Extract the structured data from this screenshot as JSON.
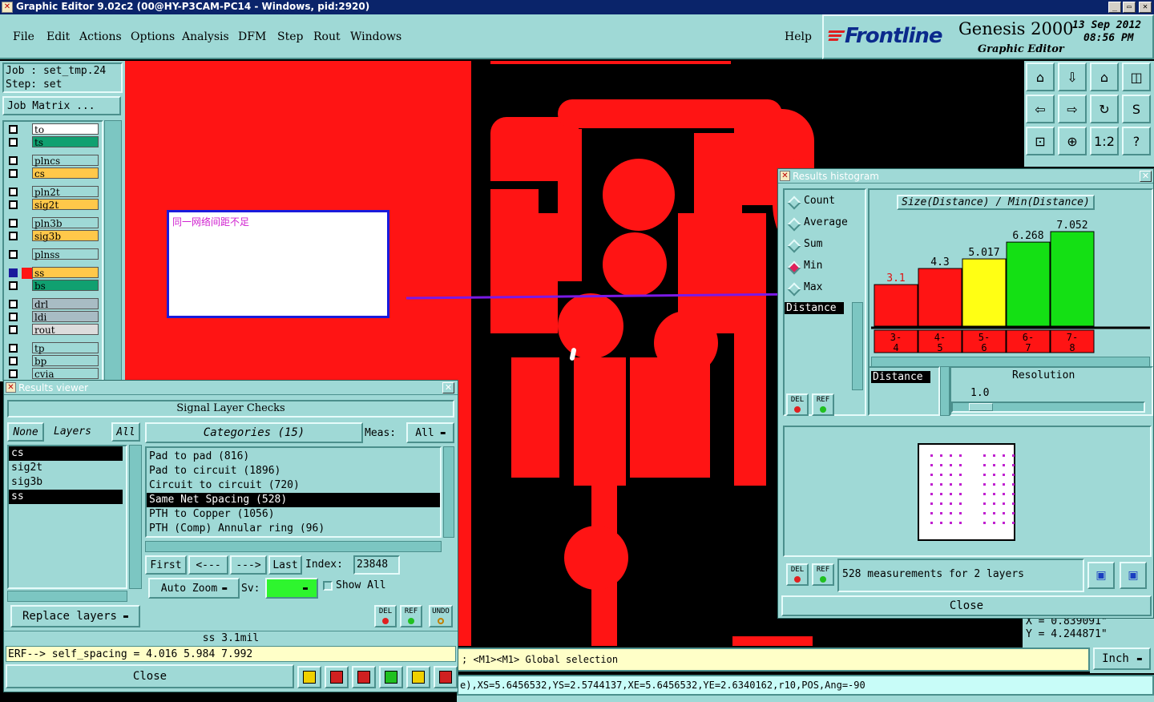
{
  "app": {
    "title": "Graphic Editor 9.02c2 (00@HY-P3CAM-PC14 - Windows, pid:2920)"
  },
  "menu": {
    "items": [
      "File",
      "Edit",
      "Actions",
      "Options",
      "Analysis",
      "DFM",
      "Step",
      "Rout",
      "Windows"
    ],
    "help": "Help"
  },
  "brand": {
    "logo": "Frontline",
    "product": "Genesis 2000",
    "subtitle": "Graphic Editor",
    "date": "13  Sep  2012",
    "time": "08:56  PM"
  },
  "job": {
    "job_line": "Job :  set_tmp.24",
    "step_line": "Step:  set",
    "matrix_button": "Job Matrix ..."
  },
  "layers": [
    {
      "name": "to",
      "color": "#ffffff"
    },
    {
      "name": "ts",
      "color": "#10a070"
    },
    {
      "name": "plncs",
      "color": "#9fd9d6"
    },
    {
      "name": "cs",
      "color": "#ffc84a"
    },
    {
      "name": "pln2t",
      "color": "#9fd9d6"
    },
    {
      "name": "sig2t",
      "color": "#ffc84a"
    },
    {
      "name": "pln3b",
      "color": "#9fd9d6"
    },
    {
      "name": "sig3b",
      "color": "#ffc84a"
    },
    {
      "name": "plnss",
      "color": "#9fd9d6"
    },
    {
      "name": "ss",
      "color": "#ffc84a"
    },
    {
      "name": "bs",
      "color": "#10a070"
    },
    {
      "name": "drl",
      "color": "#a8bcc4"
    },
    {
      "name": "ldi",
      "color": "#a8bcc4"
    },
    {
      "name": "rout",
      "color": "#dcdcdc"
    },
    {
      "name": "tp",
      "color": "#9fd9d6"
    },
    {
      "name": "bp",
      "color": "#9fd9d6"
    },
    {
      "name": "cvia",
      "color": "#9fd9d6"
    }
  ],
  "canvas": {
    "note_text": "同一网络间距不足",
    "coords_x": "X  =  0.839091\"",
    "coords_y": "Y  =  4.244871\""
  },
  "status": {
    "prompt": "; <M1><M1> Global selection",
    "unit": "Inch",
    "feature": "e),XS=5.6456532,YS=2.5744137,XE=5.6456532,YE=2.6340162,r10,POS,Ang=-90"
  },
  "results_viewer": {
    "title": "Results viewer",
    "header": "Signal Layer Checks",
    "none_btn": "None",
    "layers_label": "Layers",
    "all_btn": "All",
    "layer_list": [
      "cs",
      "sig2t",
      "sig3b",
      "ss"
    ],
    "categories_label": "Categories (15)",
    "meas_label": "Meas:",
    "meas_value": "All",
    "categories": [
      "Pad to pad (816)",
      "Pad to circuit (1896)",
      "Circuit to circuit (720)",
      "Same Net Spacing (528)",
      "PTH to Copper (1056)",
      "PTH (Comp) Annular ring (96)"
    ],
    "first_btn": "First",
    "prev_btn": "<---",
    "next_btn": "--->",
    "last_btn": "Last",
    "index_label": "Index:",
    "index_value": "23848",
    "autozoom": "Auto Zoom",
    "sv_label": "Sv:",
    "show_all": "Show All",
    "replace_layers": "Replace layers",
    "del": "DEL",
    "ref": "REF",
    "undo": "UNDO",
    "measure": "ss 3.1mil",
    "erf": "ERF--> self_spacing = 4.016 5.984 7.992",
    "close": "Close"
  },
  "histogram": {
    "title": "Results histogram",
    "modes": [
      "Count",
      "Average",
      "Sum",
      "Min",
      "Max"
    ],
    "selected_mode": "Min",
    "field_list": [
      "Distance"
    ],
    "chart_title": "Size(Distance) / Min(Distance)",
    "bars": [
      {
        "label": "3.1",
        "bin": "3-4",
        "value": 3.1,
        "color": "#ff1414"
      },
      {
        "label": "4.3",
        "bin": "4-5",
        "value": 4.3,
        "color": "#ff1414"
      },
      {
        "label": "5.017",
        "bin": "5-6",
        "value": 5.017,
        "color": "#ffff14"
      },
      {
        "label": "6.268",
        "bin": "6-7",
        "value": 6.268,
        "color": "#14e014"
      },
      {
        "label": "7.052",
        "bin": "7-8",
        "value": 7.052,
        "color": "#14e014"
      }
    ],
    "size_field": "Distance",
    "resolution_label": "Resolution",
    "resolution_value": "1.0",
    "measurements": "528 measurements for 2 layers",
    "close": "Close",
    "del": "DEL",
    "ref": "REF"
  }
}
